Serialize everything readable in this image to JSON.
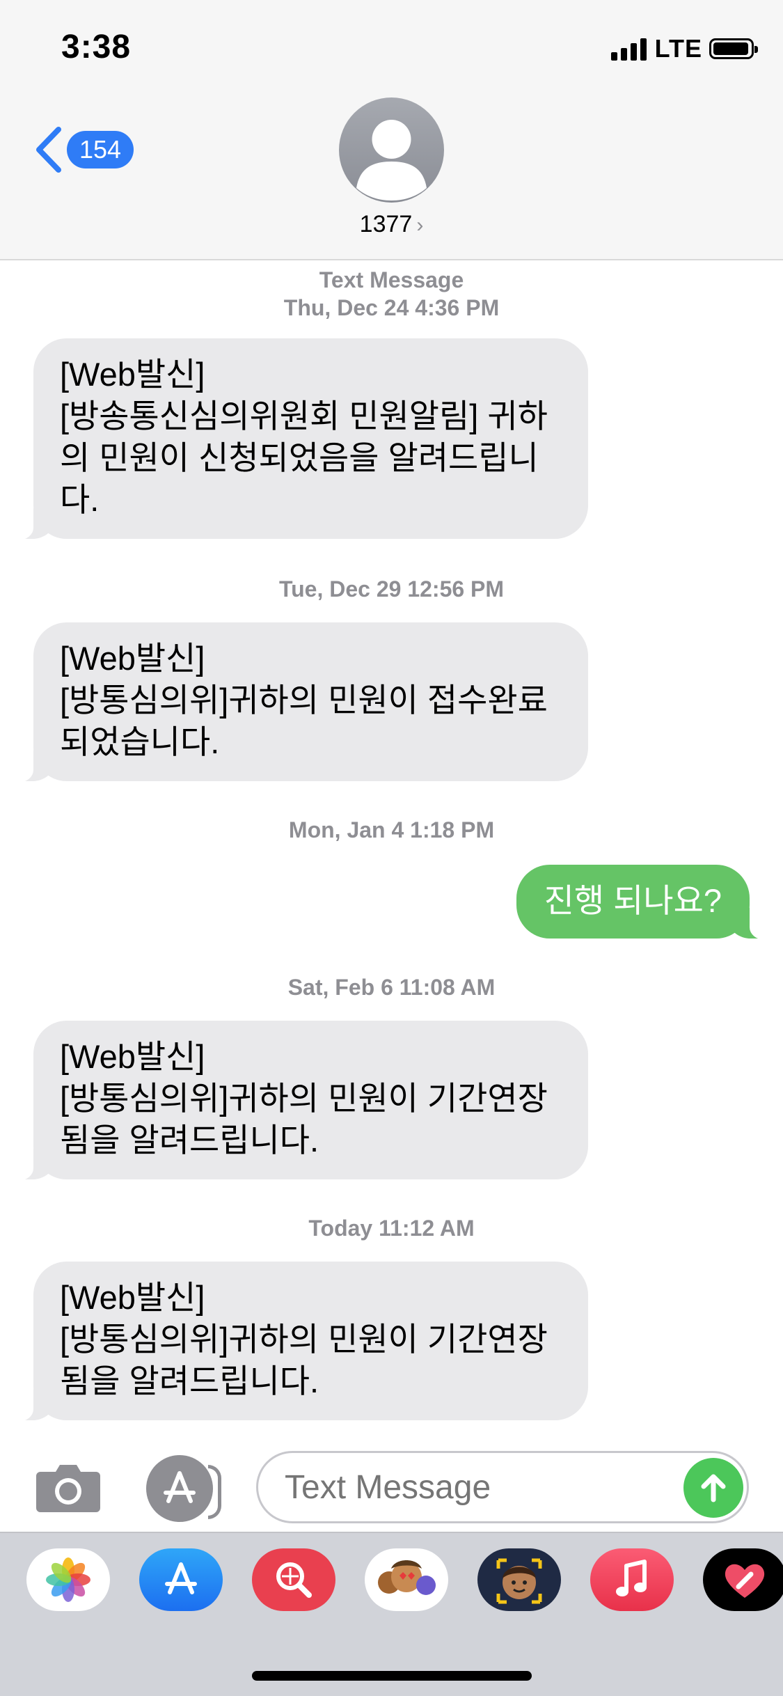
{
  "status_bar": {
    "time": "3:38",
    "network": "LTE"
  },
  "header": {
    "back_count": "154",
    "contact_name": "1377",
    "contact_chevron": "›"
  },
  "messages": [
    {
      "type": "timestamp",
      "lines": [
        "Text Message",
        "Thu, Dec 24 4:36 PM"
      ]
    },
    {
      "type": "incoming",
      "lines": [
        "[Web발신]",
        "[방송통신심의위원회 민원알림] 귀하",
        "의 민원이 신청되었음을 알려드립니",
        "다."
      ]
    },
    {
      "type": "timestamp",
      "lines": [
        "Tue, Dec 29 12:56 PM"
      ]
    },
    {
      "type": "incoming",
      "lines": [
        "[Web발신]",
        "[방통심의위]귀하의 민원이 접수완료",
        "되었습니다."
      ]
    },
    {
      "type": "timestamp",
      "lines": [
        "Mon, Jan 4 1:18 PM"
      ]
    },
    {
      "type": "outgoing",
      "lines": [
        "진행 되나요?"
      ]
    },
    {
      "type": "timestamp",
      "lines": [
        "Sat, Feb 6 11:08 AM"
      ]
    },
    {
      "type": "incoming",
      "lines": [
        "[Web발신]",
        "[방통심의위]귀하의 민원이 기간연장",
        "됨을 알려드립니다."
      ]
    },
    {
      "type": "timestamp",
      "lines": [
        "Today 11:12 AM"
      ]
    },
    {
      "type": "incoming",
      "lines": [
        "[Web발신]",
        "[방통심의위]귀하의 민원이 기간연장",
        "됨을 알려드립니다."
      ]
    }
  ],
  "composer": {
    "placeholder": "Text Message"
  },
  "app_drawer": [
    {
      "icon": "photos-icon"
    },
    {
      "icon": "app-store-icon"
    },
    {
      "icon": "web-search-icon"
    },
    {
      "icon": "animoji-stickers-icon"
    },
    {
      "icon": "memoji-icon"
    },
    {
      "icon": "music-icon"
    },
    {
      "icon": "digital-touch-icon"
    }
  ],
  "colors": {
    "incoming_bubble": "#e9e9eb",
    "outgoing_bubble": "#65c466",
    "accent_blue": "#2f7cf6",
    "timestamp_gray": "#8e8e93"
  }
}
